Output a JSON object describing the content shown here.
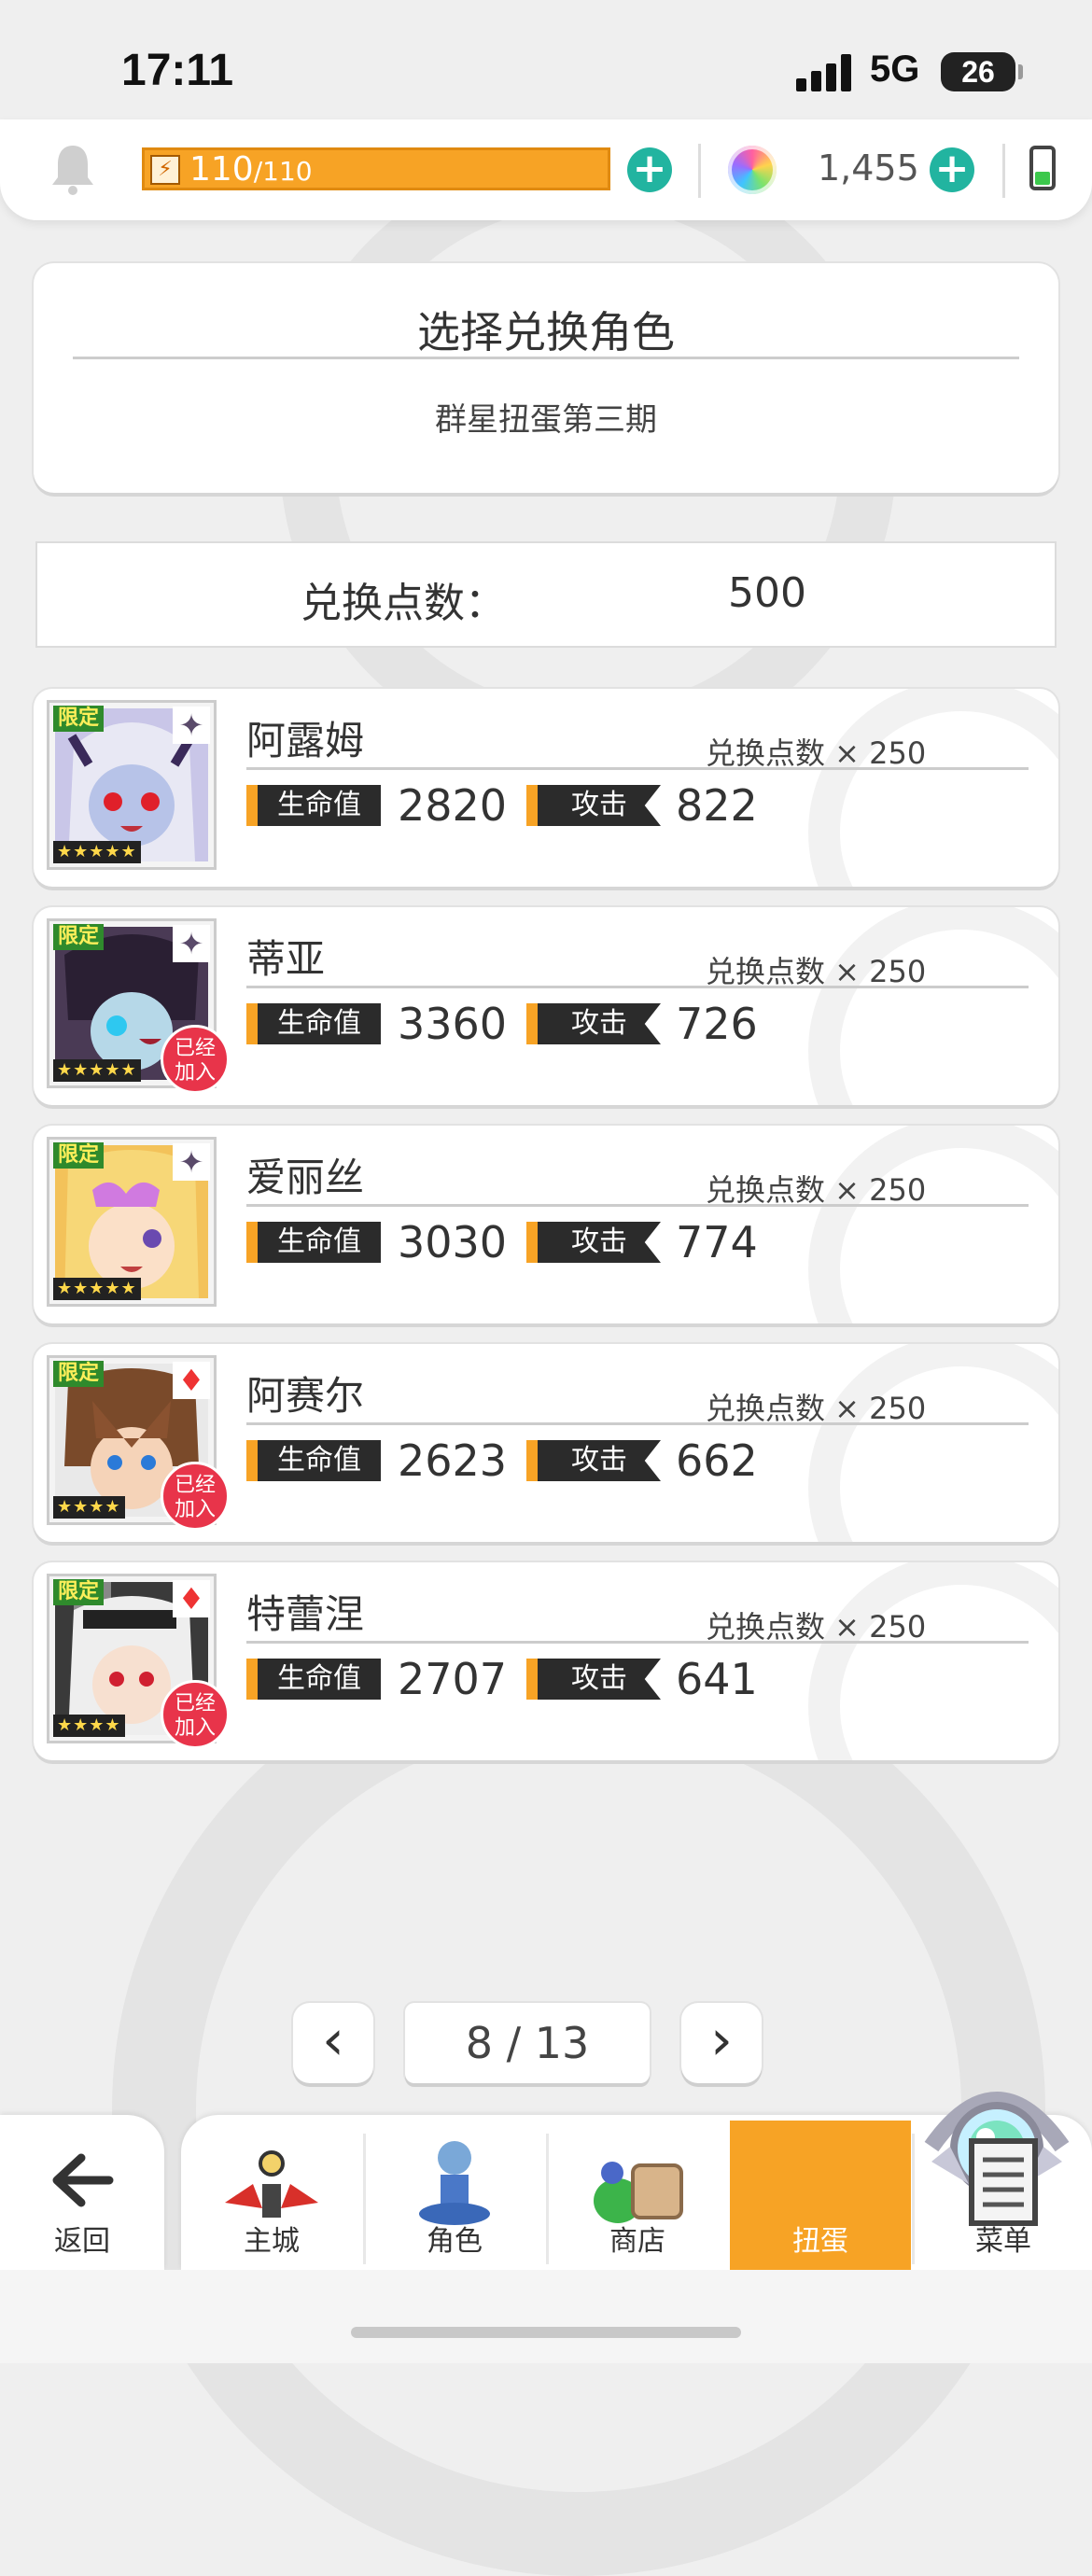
{
  "status_bar": {
    "time": "17:11",
    "network": "5G",
    "battery": "26"
  },
  "resources": {
    "energy_current": "110",
    "energy_max": "/110",
    "energy_fill": 1.0,
    "gems": "1,455"
  },
  "header": {
    "title": "选择兑换角色",
    "subtitle": "群星扭蛋第三期"
  },
  "points": {
    "label": "兑换点数：",
    "value": "500"
  },
  "characters": [
    {
      "name": "阿露姆",
      "cost": "兑换点数 × 250",
      "tag": "限定",
      "stars": "★★★★★",
      "hp_label": "生命值",
      "hp": "2820",
      "atk_label": "攻击",
      "atk": "822",
      "joined": false
    },
    {
      "name": "蒂亚",
      "cost": "兑换点数 × 250",
      "tag": "限定",
      "stars": "★★★★★",
      "hp_label": "生命值",
      "hp": "3360",
      "atk_label": "攻击",
      "atk": "726",
      "joined": true,
      "joined_label": "已经\n加入"
    },
    {
      "name": "爱丽丝",
      "cost": "兑换点数 × 250",
      "tag": "限定",
      "stars": "★★★★★",
      "hp_label": "生命值",
      "hp": "3030",
      "atk_label": "攻击",
      "atk": "774",
      "joined": false
    },
    {
      "name": "阿赛尔",
      "cost": "兑换点数 × 250",
      "tag": "限定",
      "stars": "★★★★",
      "hp_label": "生命值",
      "hp": "2623",
      "atk_label": "攻击",
      "atk": "662",
      "joined": true,
      "joined_label": "已经\n加入"
    },
    {
      "name": "特蕾涅",
      "cost": "兑换点数 × 250",
      "tag": "限定",
      "stars": "★★★★",
      "hp_label": "生命值",
      "hp": "2707",
      "atk_label": "攻击",
      "atk": "641",
      "joined": true,
      "joined_label": "已经\n加入"
    }
  ],
  "pagination": {
    "label": "8 / 13",
    "prev": "‹",
    "next": "›"
  },
  "nav": {
    "back": "返回",
    "items": [
      "主城",
      "角色",
      "商店",
      "扭蛋",
      "菜单"
    ],
    "active": "扭蛋"
  },
  "colors": {
    "accent": "#f7a325",
    "teal": "#22b4a0",
    "joined": "#e8344a"
  }
}
